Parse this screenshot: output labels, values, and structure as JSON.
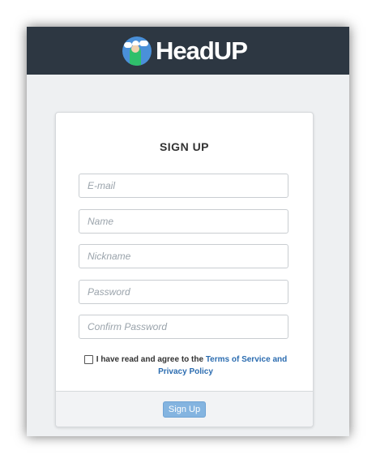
{
  "header": {
    "brand_name": "HeadUP",
    "background_color": "#2d3742"
  },
  "form": {
    "title": "SIGN UP",
    "fields": {
      "email_placeholder": "E-mail",
      "name_placeholder": "Name",
      "nickname_placeholder": "Nickname",
      "password_placeholder": "Password",
      "confirm_password_placeholder": "Confirm Password"
    },
    "agreement": {
      "checked": false,
      "text": "I have read and agree to the",
      "link_part1": "Terms of Service and",
      "link_part2": "Privacy Policy"
    },
    "submit_label": "Sign Up",
    "link_color": "#2b6cb0",
    "button_color": "#84b4e0"
  }
}
